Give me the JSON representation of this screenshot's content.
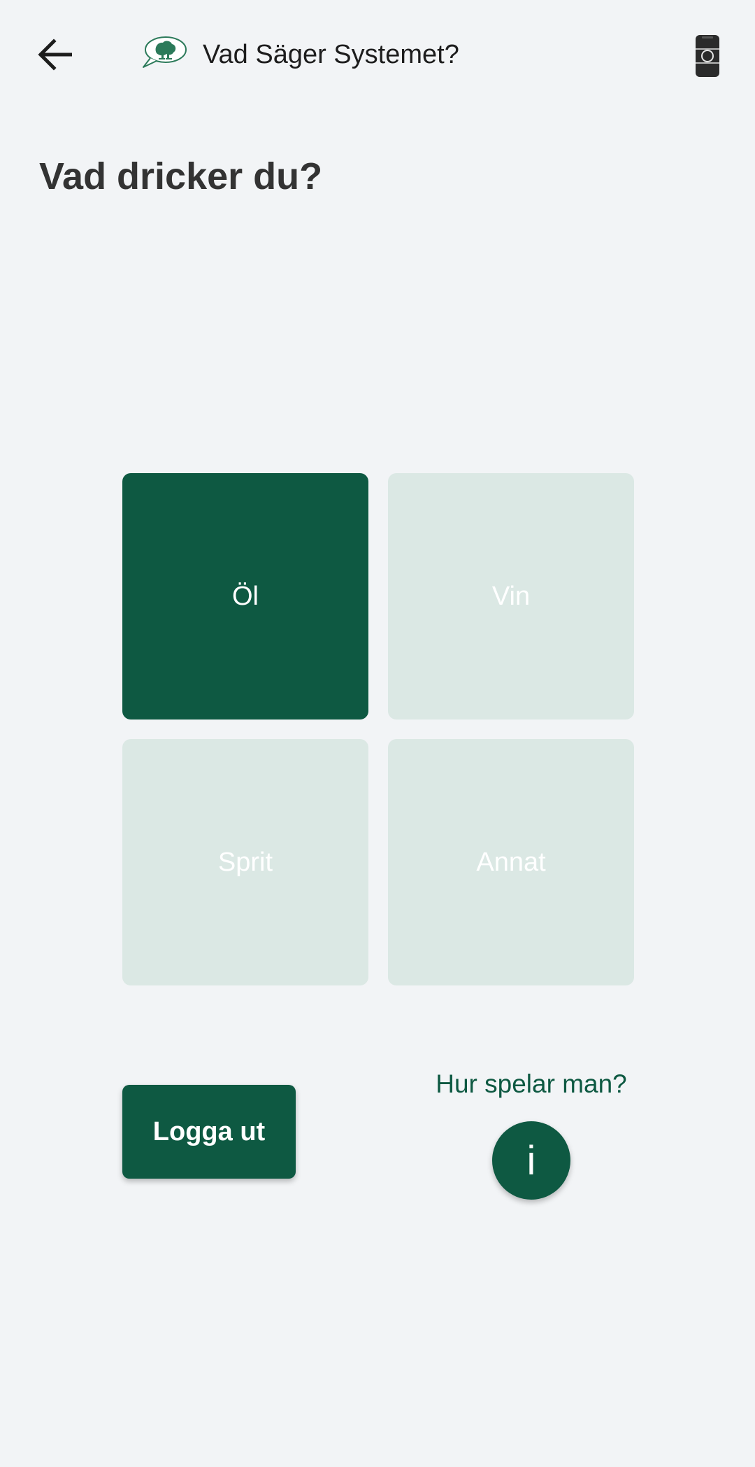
{
  "header": {
    "back_icon": "arrow-left-icon",
    "logo_icon": "speech-bubble-tree-logo",
    "title": "Vad Säger Systemet?",
    "right_icon": "phone-icon"
  },
  "main": {
    "heading": "Vad dricker du?",
    "categories": [
      {
        "label": "Öl",
        "selected": true
      },
      {
        "label": "Vin",
        "selected": false
      },
      {
        "label": "Sprit",
        "selected": false
      },
      {
        "label": "Annat",
        "selected": false
      }
    ]
  },
  "footer": {
    "logout_label": "Logga ut",
    "howto_label": "Hur spelar man?",
    "info_label": "i",
    "info_icon": "info-icon"
  },
  "colors": {
    "background": "#f2f4f6",
    "primary": "#0e5942",
    "tile_inactive": "#dbe8e4",
    "text_dark": "#333333"
  }
}
